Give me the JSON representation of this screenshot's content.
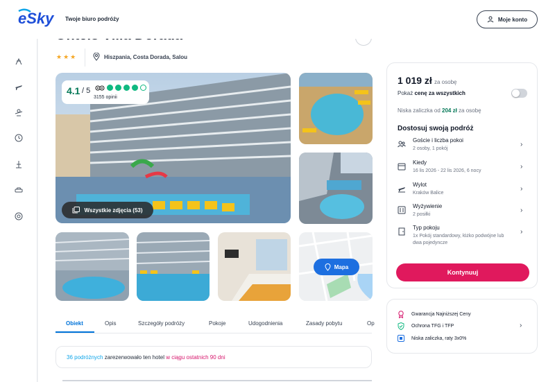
{
  "header": {
    "logo": "eSky",
    "tagline": "Twoje biuro podróży",
    "account_label": "Moje konto"
  },
  "sidebar": {
    "icons": [
      "beach-icon",
      "plane-icon",
      "plane-hotel-icon",
      "last-minute-icon",
      "trips-icon",
      "car-icon",
      "help-icon"
    ]
  },
  "hotel": {
    "title": "Ohtels Villa Dorada",
    "stars": "★★★",
    "location": "Hiszpania, Costa Dorada, Salou",
    "rating": "4.1",
    "rating_of": "/ 5",
    "tripadvisor_dots": 4,
    "reviews": "3155 opinii",
    "all_photos_label": "Wszystkie zdjęcia (53)",
    "map_label": "Mapa"
  },
  "tabs": [
    "Obiekt",
    "Opis",
    "Szczegóły podróży",
    "Pokoje",
    "Udogodnienia",
    "Zasady pobytu",
    "Op"
  ],
  "booked": {
    "count": "36 podróżnych",
    "middle": " zarezerwowało ten hotel ",
    "period": "w ciągu ostatnich 90 dni"
  },
  "booking": {
    "price": "1 019 zł",
    "per_person": "za osobę",
    "show_total_prefix": "Pokaż ",
    "show_total_bold": "cenę za wszystkich",
    "deposit_prefix": "Niska zaliczka od ",
    "deposit_amount": "204 zł",
    "deposit_suffix": " za osobę",
    "customize_title": "Dostosuj swoją podróż",
    "options": [
      {
        "title": "Goście i liczba pokoi",
        "sub": "2 osoby, 1 pokój",
        "icon": "guests-icon"
      },
      {
        "title": "Kiedy",
        "sub": "16 lis 2026 - 22 lis 2026, 6 nocy",
        "icon": "calendar-icon"
      },
      {
        "title": "Wylot",
        "sub": "Kraków Balice",
        "icon": "departure-icon"
      },
      {
        "title": "Wyżywienie",
        "sub": "2 posiłki",
        "icon": "meals-icon"
      },
      {
        "title": "Typ pokoju",
        "sub": "1x Pokój standardowy, łóżko podwójne lub dwa pojedyncze",
        "icon": "door-icon"
      }
    ],
    "continue_label": "Kontynuuj"
  },
  "guarantees": [
    {
      "label": "Gwarancja Najniższej Ceny",
      "icon": "medal-icon",
      "color": "#d6156b"
    },
    {
      "label": "Ochrona TFG i TFP",
      "icon": "shield-check-icon",
      "color": "#10b981"
    },
    {
      "label": "Niska zaliczka, raty 3x0%",
      "icon": "card-icon",
      "color": "#1d6fe0"
    }
  ],
  "colors": {
    "accent": "#e0195d",
    "brand_blue": "#0073d9",
    "rating_green": "#047857"
  }
}
